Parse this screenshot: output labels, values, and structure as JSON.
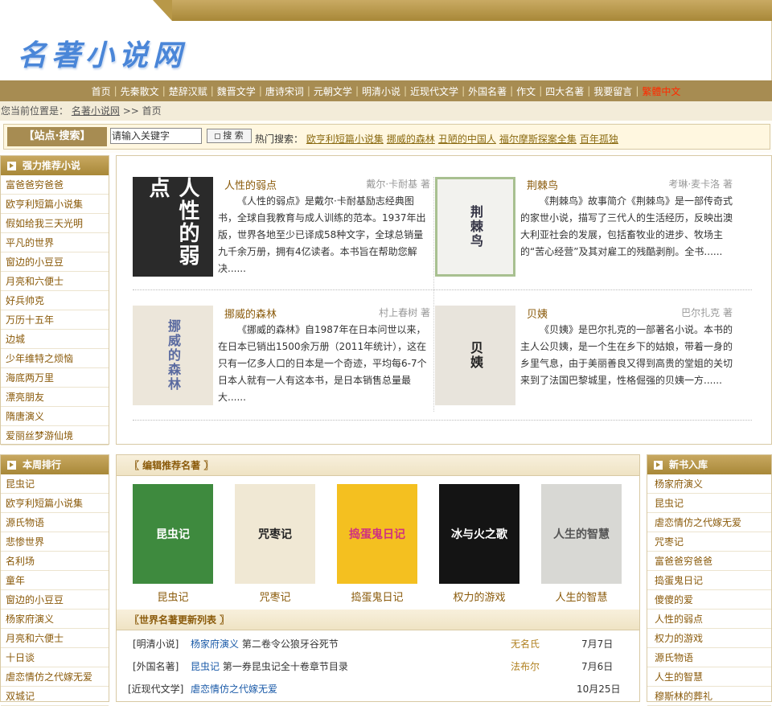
{
  "site": {
    "logo_text": "名著小说网"
  },
  "nav": {
    "items": [
      "首页",
      "先秦散文",
      "楚辞汉赋",
      "魏晋文学",
      "唐诗宋词",
      "元朝文学",
      "明清小说",
      "近现代文学",
      "外国名著",
      "作文",
      "四大名著",
      "我要留言"
    ],
    "trad": "繁體中文"
  },
  "breadcrumb": {
    "prefix": "您当前位置是：",
    "home": "名著小说网",
    "sep": ">>",
    "current": "首页"
  },
  "search": {
    "title": "【站点·搜索】",
    "input_value": "请输入关键字",
    "button": "搜 索",
    "hot_label": "热门搜索：",
    "hot": [
      "欧亨利短篇小说集",
      "挪威的森林",
      "丑陋的中国人",
      "福尔摩斯探案全集",
      "百年孤独"
    ]
  },
  "recommend": {
    "title": "强力推荐小说",
    "items": [
      "富爸爸穷爸爸",
      "欧亨利短篇小说集",
      "假如给我三天光明",
      "平凡的世界",
      "窗边的小豆豆",
      "月亮和六便士",
      "好兵帅克",
      "万历十五年",
      "边城",
      "少年维特之烦恼",
      "海底两万里",
      "漂亮朋友",
      "隋唐演义",
      "爱丽丝梦游仙境"
    ]
  },
  "featured": [
    {
      "title": "人性的弱点",
      "author": "戴尔·卡耐基 著",
      "desc": "《人性的弱点》是戴尔·卡耐基励志经典图书，全球自我教育与成人训练的范本。1937年出版，世界各地至少已译成58种文字，全球总销量九千余万册，拥有4亿读者。本书旨在帮助您解决......",
      "cover": "人性的弱点"
    },
    {
      "title": "荆棘鸟",
      "author": "考琳·麦卡洛 著",
      "desc": "《荆棘鸟》故事简介《荆棘鸟》是一部传奇式的家世小说，描写了三代人的生活经历，反映出澳大利亚社会的发展，包括畜牧业的进步、牧场主的“苦心经营”及其对雇工的残酷剥削。全书......",
      "cover": "荆棘鸟"
    },
    {
      "title": "挪威的森林",
      "author": "村上春树 著",
      "desc": "《挪威的森林》自1987年在日本问世以来，在日本已销出1500余万册（2011年统计），这在只有一亿多人口的日本是一个奇迹，平均每6-7个日本人就有一人有这本书，是日本销售总量最大......",
      "cover": "挪威的森林"
    },
    {
      "title": "贝姨",
      "author": "巴尔扎克 著",
      "desc": "《贝姨》是巴尔扎克的一部著名小说。本书的主人公贝姨，是一个生在乡下的姑娘，带着一身的乡里气息，由于美丽善良又得到高贵的堂姐的关切来到了法国巴黎城里，性格倔强的贝姨一方......",
      "cover": "贝姨"
    }
  ],
  "week": {
    "title": "本周排行",
    "items": [
      "昆虫记",
      "欧亨利短篇小说集",
      "源氏物语",
      "悲惨世界",
      "名利场",
      "童年",
      "窗边的小豆豆",
      "杨家府演义",
      "月亮和六便士",
      "十日谈",
      "虐恋情仿之代嫁无爱",
      "双城记"
    ]
  },
  "editor": {
    "title": "〖 编辑推荐名著 〗",
    "books": [
      "昆虫记",
      "咒枣记",
      "捣蛋鬼日记",
      "权力的游戏",
      "人生的智慧"
    ],
    "cover_texts": [
      "昆虫记",
      "咒枣记",
      "捣蛋鬼日记",
      "冰与火之歌",
      "人生的智慧"
    ]
  },
  "updates": {
    "title": "〖世界名著更新列表 〗",
    "rows": [
      {
        "cat": "[明清小说]",
        "book": "杨家府演义",
        "chapter": " 第二卷令公狼牙谷死节",
        "author": "无名氏",
        "date": "7月7日"
      },
      {
        "cat": "[外国名著]",
        "book": "昆虫记",
        "chapter": " 第一券昆虫记全十卷章节目录",
        "author": "法布尔",
        "date": "7月6日"
      },
      {
        "cat": "[近现代文学]",
        "book": "虐恋情仿之代嫁无爱",
        "chapter": "",
        "author": "",
        "date": "10月25日"
      }
    ]
  },
  "newbooks": {
    "title": "新书入库",
    "items": [
      "杨家府演义",
      "昆虫记",
      "虐恋情仿之代嫁无爱",
      "咒枣记",
      "富爸爸穷爸爸",
      "捣蛋鬼日记",
      "傻傻的爱",
      "人性的弱点",
      "权力的游戏",
      "源氏物语",
      "人生的智慧",
      "穆斯林的葬礼"
    ]
  },
  "colors": {
    "gold": "#a78c52",
    "link": "#8a5a0a",
    "blue": "#1a5aa8",
    "red": "#ff2a00"
  }
}
